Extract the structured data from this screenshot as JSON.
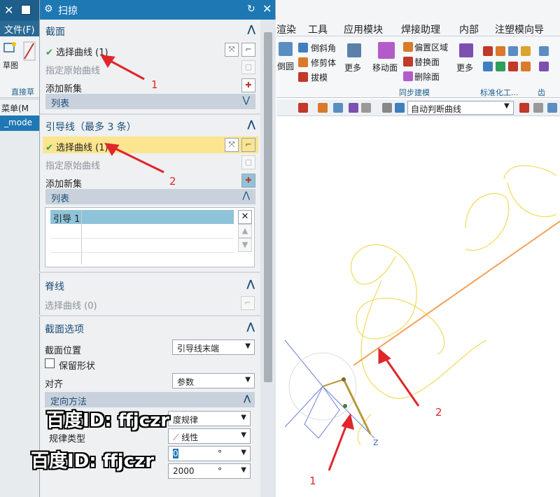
{
  "app": {
    "menu_file": "文件(F)",
    "ribbon_left_label1": "草图",
    "ribbon_left_label2": "直接草",
    "menu_label": "菜单(M",
    "model_tab": "_mode"
  },
  "dialog": {
    "title": "扫掠",
    "section": {
      "title": "截面",
      "select_curve": "选择曲线 (1)",
      "specify_origin": "指定原始曲线",
      "add_new_set": "添加新集",
      "list": "列表"
    },
    "guide": {
      "title": "引导线（最多 3 条）",
      "select_curve": "选择曲线 (1)",
      "specify_origin": "指定原始曲线",
      "add_new_set": "添加新集",
      "list": "列表",
      "list_item": "引导 1"
    },
    "spine": {
      "title": "脊线",
      "select_curve": "选择曲线 (0)"
    },
    "options": {
      "title": "截面选项",
      "position_label": "截面位置",
      "position_value": "引导线末端",
      "keep_shape": "保留形状",
      "align_label": "对齐",
      "align_value": "参数",
      "orient_label": "定向方法",
      "law_value": "度规律",
      "law_type_label": "规律类型",
      "law_type_value": "线性",
      "start_value": "0",
      "start_unit": "°",
      "end_value": "2000",
      "end_unit": "°"
    }
  },
  "ribbon": {
    "tabs": [
      "渲染",
      "工具",
      "应用模块",
      "焊接助理",
      "内部",
      "注塑模向导"
    ],
    "chamfer": "倒斜角",
    "trim_body": "修剪体",
    "draft": "拔模",
    "round": "倒圆",
    "more": "更多",
    "move_face": "移动面",
    "offset_region": "偏置区域",
    "replace_face": "替换面",
    "delete_face": "删除面",
    "more2": "更多",
    "sync_group": "同步建模",
    "std_group": "标准化工...",
    "gear_group": "齿",
    "curve_rule": "自动判断曲线"
  },
  "annotations": {
    "a1": "1",
    "a2": "2",
    "b1": "1",
    "b2": "2"
  },
  "watermark": {
    "text1": "百度ID: ffjczr",
    "text2": "百度ID: ffjczr"
  },
  "viewport": {
    "axis_z": "Z"
  },
  "colors": {
    "accent": "#1e78b4",
    "highlight": "#fce58f",
    "arrow": "#e0262b",
    "curve_yellow": "#f2dd66",
    "line_orange": "#f2a25a"
  }
}
